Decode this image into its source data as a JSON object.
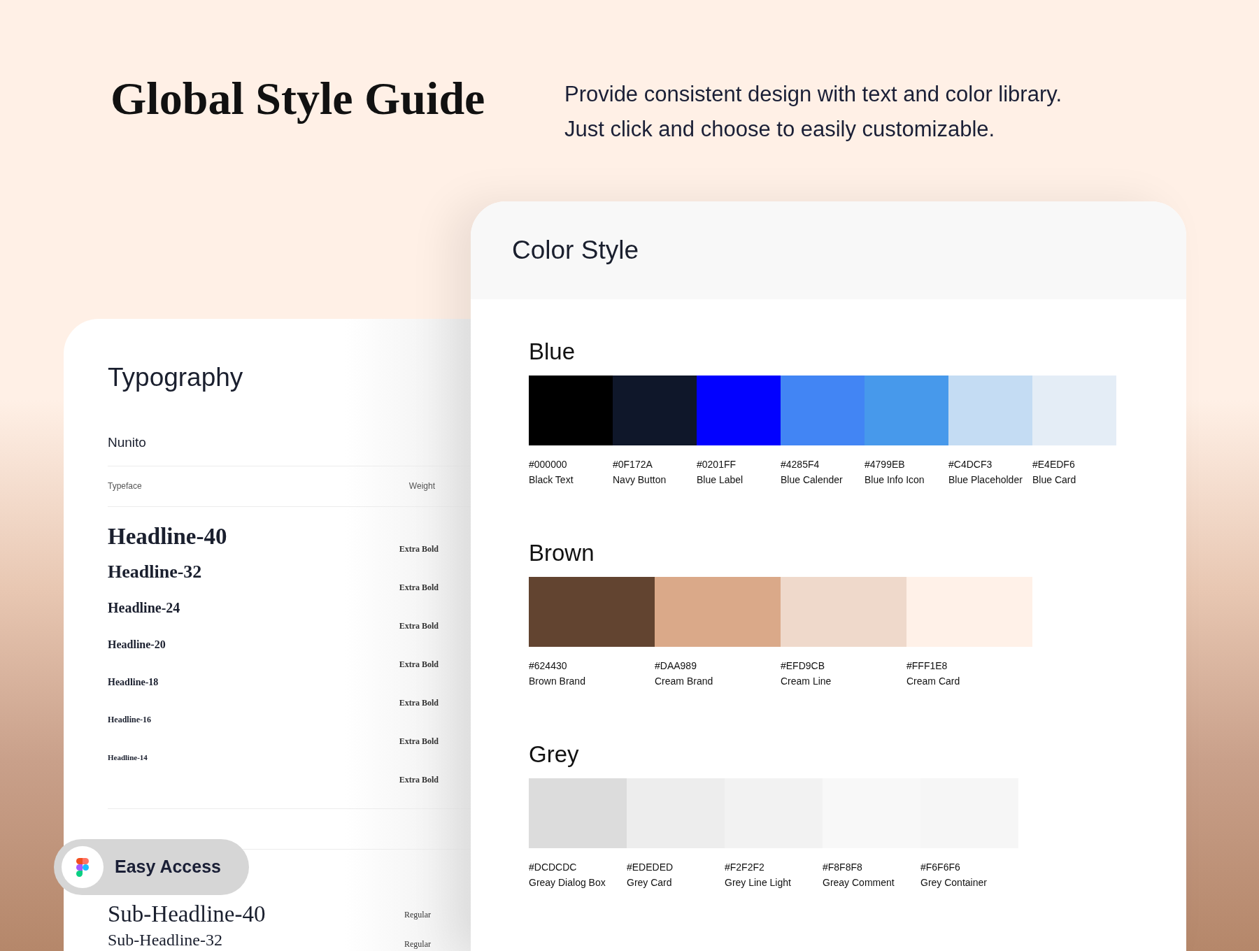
{
  "header": {
    "title": "Global Style Guide",
    "subtitle_lines": [
      "Provide consistent design with text and color library.",
      "Just click and choose to easily customizable."
    ]
  },
  "typography_card": {
    "title": "Typography",
    "font_name": "Nunito",
    "columns": [
      "Typeface",
      "Weight"
    ],
    "headlines": [
      {
        "label": "Headline-40",
        "weight": "Extra Bold"
      },
      {
        "label": "Headline-32",
        "weight": "Extra Bold"
      },
      {
        "label": "Headline-24",
        "weight": "Extra Bold"
      },
      {
        "label": "Headline-20",
        "weight": "Extra Bold"
      },
      {
        "label": "Headline-18",
        "weight": "Extra Bold"
      },
      {
        "label": "Headline-16",
        "weight": "Extra Bold"
      },
      {
        "label": "Headline-14",
        "weight": "Extra Bold"
      }
    ],
    "sub_headlines": [
      {
        "label": "Sub-Headline-40",
        "weight": "Regular"
      },
      {
        "label": "Sub-Headline-32",
        "weight": "Regular"
      }
    ]
  },
  "color_card": {
    "title": "Color Style",
    "groups": [
      {
        "name": "Blue",
        "swatches": [
          {
            "hex": "#000000",
            "name": "Black Text",
            "color": "#000000"
          },
          {
            "hex": "#0F172A",
            "name": "Navy Button",
            "color": "#0f172a"
          },
          {
            "hex": "#0201FF",
            "name": "Blue Label",
            "color": "#0201ff"
          },
          {
            "hex": "#4285F4",
            "name": "Blue Calender",
            "color": "#4285f4"
          },
          {
            "hex": "#4799EB",
            "name": "Blue Info Icon",
            "color": "#4799eb"
          },
          {
            "hex": "#C4DCF3",
            "name": "Blue Placeholder",
            "color": "#c4dcf3"
          },
          {
            "hex": "#E4EDF6",
            "name": "Blue Card",
            "color": "#e4edf6"
          }
        ]
      },
      {
        "name": "Brown",
        "swatches": [
          {
            "hex": "#624430",
            "name": "Brown Brand",
            "color": "#624430"
          },
          {
            "hex": "#DAA989",
            "name": "Cream Brand",
            "color": "#daa989"
          },
          {
            "hex": "#EFD9CB",
            "name": "Cream Line",
            "color": "#efd9cb"
          },
          {
            "hex": "#FFF1E8",
            "name": "Cream Card",
            "color": "#fff1e8"
          }
        ]
      },
      {
        "name": "Grey",
        "swatches": [
          {
            "hex": "#DCDCDC",
            "name": "Greay Dialog Box",
            "color": "#dcdcdc"
          },
          {
            "hex": "#EDEDED",
            "name": "Grey Card",
            "color": "#ededed"
          },
          {
            "hex": "#F2F2F2",
            "name": "Grey Line Light",
            "color": "#f2f2f2"
          },
          {
            "hex": "#F8F8F8",
            "name": "Greay Comment",
            "color": "#f8f8f8"
          },
          {
            "hex": "#F6F6F6",
            "name": "Grey Container",
            "color": "#f6f6f6"
          }
        ]
      }
    ]
  },
  "badge": {
    "label": "Easy Access"
  }
}
